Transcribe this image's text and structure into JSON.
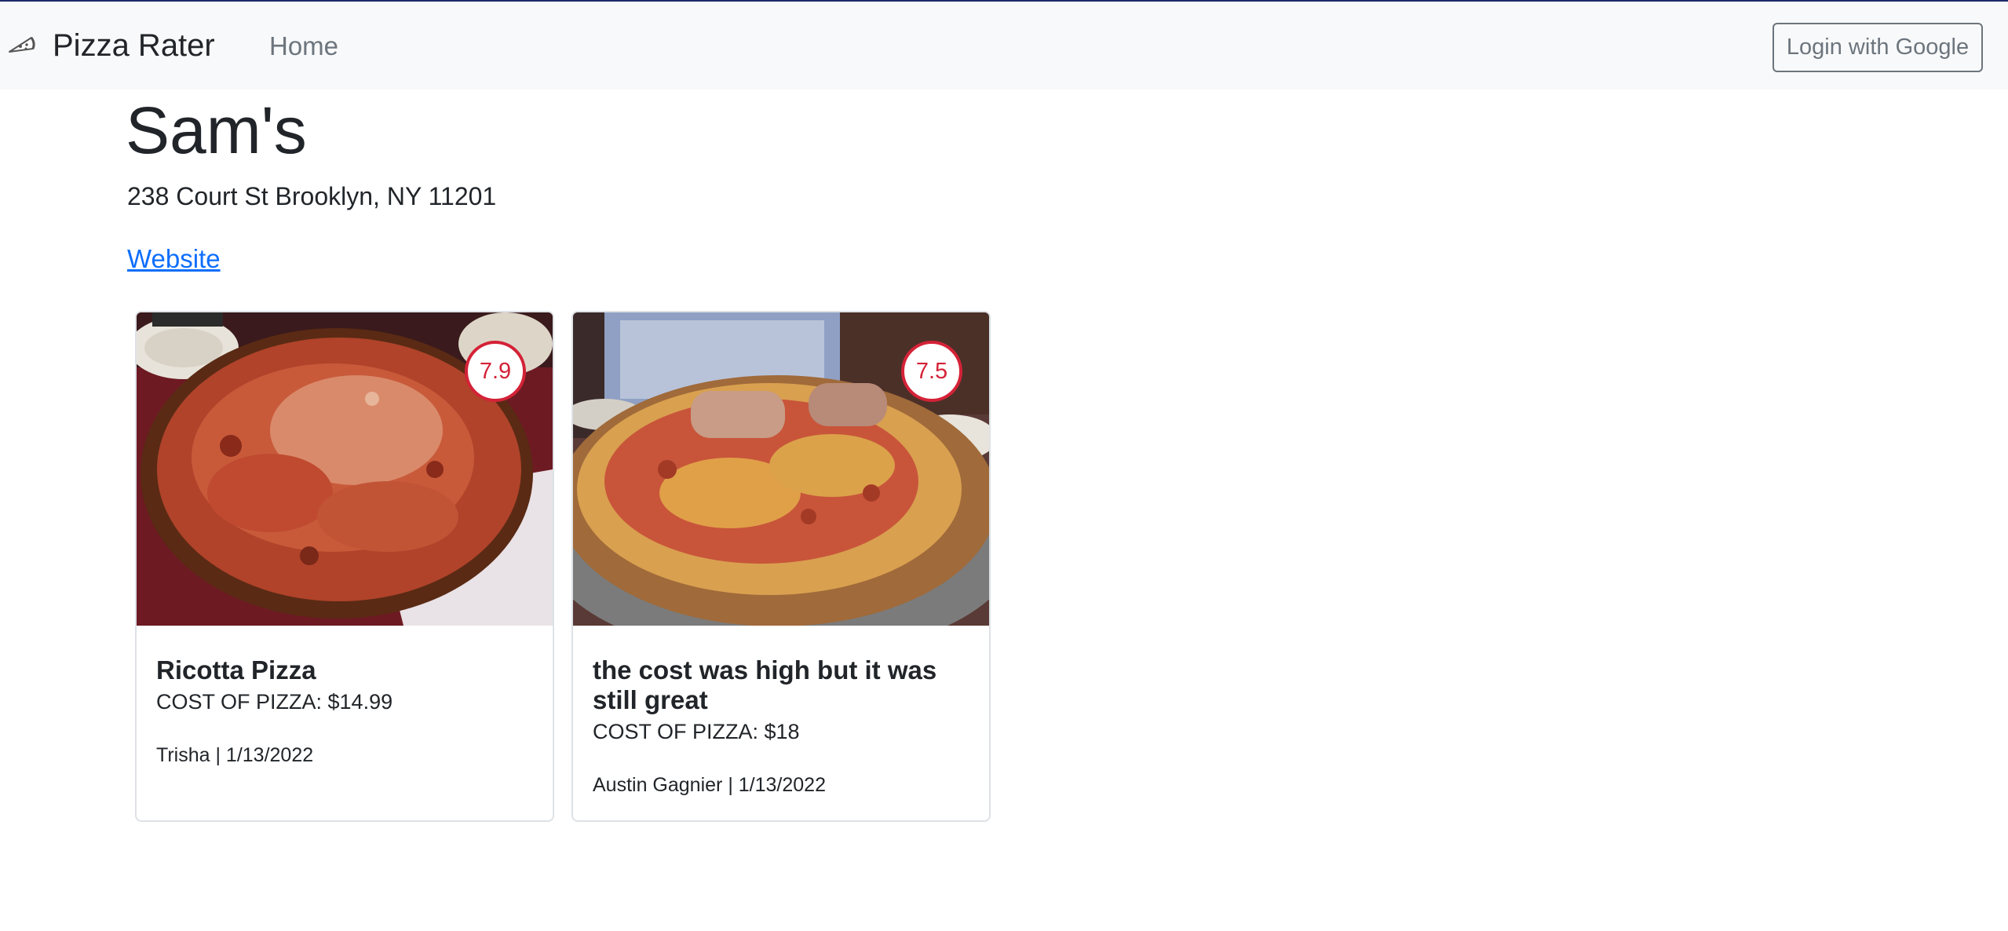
{
  "navbar": {
    "brand": "Pizza Rater",
    "brand_icon": "pizza-slice-icon",
    "home_link": "Home",
    "login_button": "Login with Google"
  },
  "restaurant": {
    "name": "Sam's",
    "address": "238 Court St Brooklyn, NY 11201",
    "website_label": "Website"
  },
  "reviews": [
    {
      "rating": "7.9",
      "title": "Ricotta Pizza",
      "cost": "COST OF PIZZA: $14.99",
      "meta": "Trisha | 1/13/2022"
    },
    {
      "rating": "7.5",
      "title": "the cost was high but it was still great",
      "cost": "COST OF PIZZA: $18",
      "meta": "Austin Gagnier | 1/13/2022"
    }
  ],
  "colors": {
    "navbar_bg": "#f8f9fa",
    "link": "#0d6efd",
    "rating_accent": "#d42237",
    "muted": "#6c757d"
  }
}
